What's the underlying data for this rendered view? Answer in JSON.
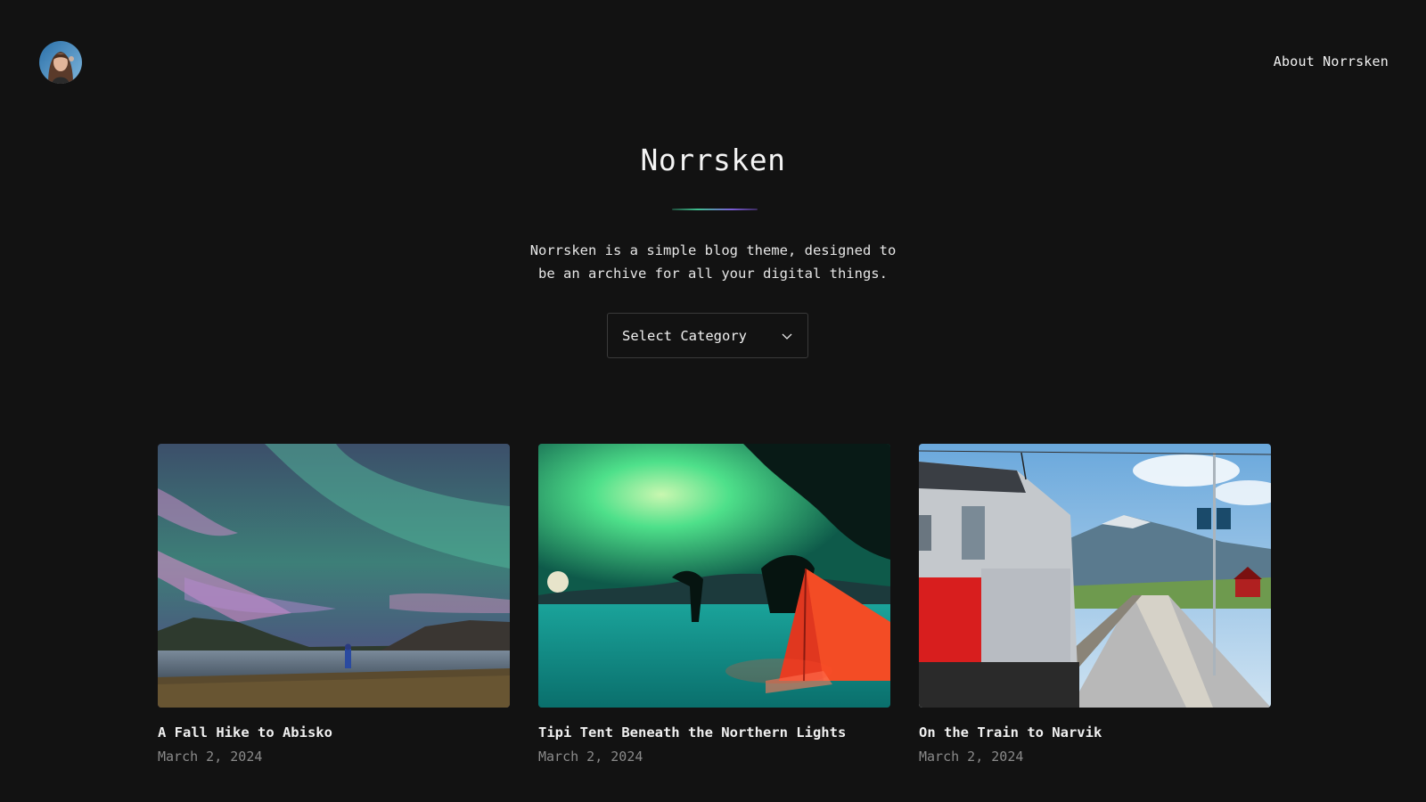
{
  "header": {
    "avatar_icon": "avatar-portrait-icon",
    "nav_link_label": "About Norrsken"
  },
  "hero": {
    "title": "Norrsken",
    "tagline_line1": "Norrsken is a simple blog theme, designed to",
    "tagline_line2": "be an archive for all your digital things.",
    "category_select": {
      "selected": "Select Category",
      "icon": "chevron-down-icon"
    }
  },
  "colors": {
    "background": "#121212",
    "text": "#ececec",
    "muted_text": "#8a8a8a",
    "border": "#3a3a3a",
    "divider_gradient": [
      "#3fbf8f",
      "#7a5cd6"
    ]
  },
  "posts": [
    {
      "title": "A Fall Hike to Abisko",
      "date": "March 2, 2024",
      "image": "aurora-lake-hiker-image"
    },
    {
      "title": "Tipi Tent Beneath the Northern Lights",
      "date": "March 2, 2024",
      "image": "aurora-tipi-tent-image"
    },
    {
      "title": "On the Train to Narvik",
      "date": "March 2, 2024",
      "image": "train-station-platform-image"
    }
  ]
}
